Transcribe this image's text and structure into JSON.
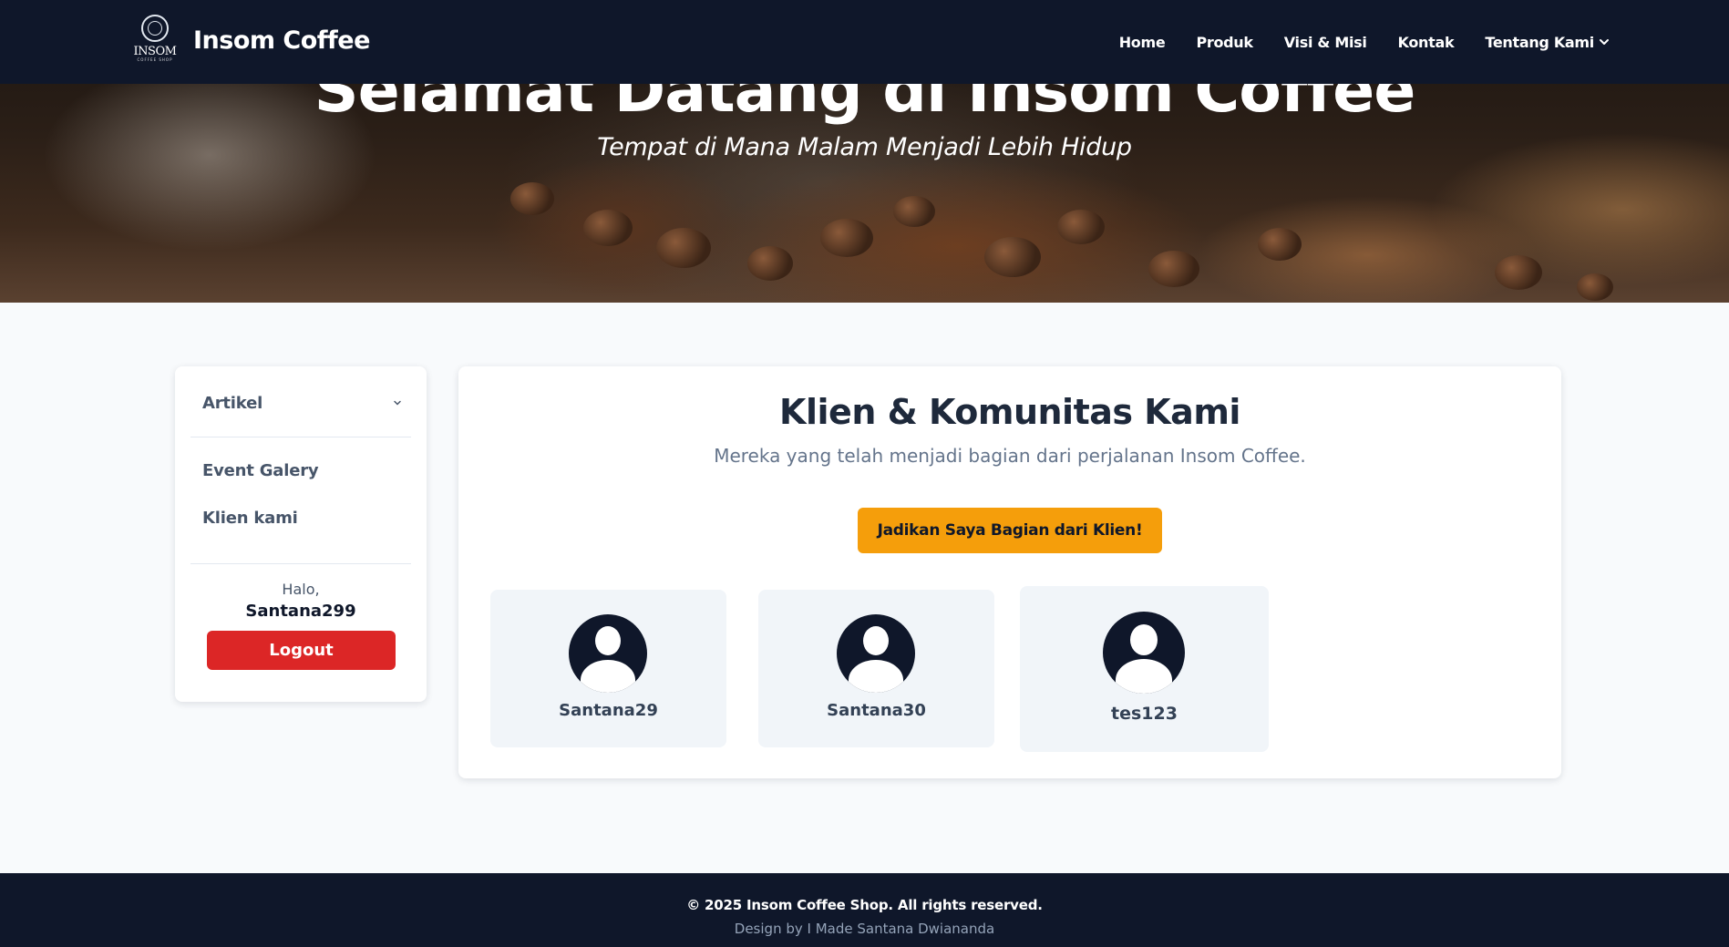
{
  "navbar": {
    "brand_name": "Insom Coffee",
    "logo_text": "INSOM",
    "logo_subtext": "COFFEE SHOP",
    "links": [
      {
        "label": "Home"
      },
      {
        "label": "Produk"
      },
      {
        "label": "Visi & Misi"
      },
      {
        "label": "Kontak"
      },
      {
        "label": "Tentang Kami",
        "icon": "chevron-down-icon"
      }
    ]
  },
  "hero": {
    "title": "Selamat Datang di Insom Coffee",
    "subtitle": "Tempat di Mana Malam Menjadi Lebih Hidup"
  },
  "sidebar": {
    "dropdown_label": "Artikel",
    "items": [
      {
        "label": "Event Galery"
      },
      {
        "label": "Klien kami"
      }
    ],
    "greeting": "Halo,",
    "username": "Santana299",
    "logout_label": "Logout"
  },
  "main": {
    "title": "Klien & Komunitas Kami",
    "subtitle": "Mereka yang telah menjadi bagian dari perjalanan Insom Coffee.",
    "join_button": "Jadikan Saya Bagian dari Klien!",
    "clients": [
      {
        "name": "Santana29",
        "icon": "user-avatar-icon"
      },
      {
        "name": "Santana30",
        "icon": "user-avatar-icon"
      },
      {
        "name": "tes123",
        "icon": "user-avatar-icon"
      }
    ]
  },
  "footer": {
    "copyright": "© 2025 Insom Coffee Shop. All rights reserved.",
    "credit": "Design by I Made Santana Dwiananda"
  },
  "colors": {
    "navy": "#0f172a",
    "accent": "#f59e0b",
    "danger": "#dc2626"
  }
}
